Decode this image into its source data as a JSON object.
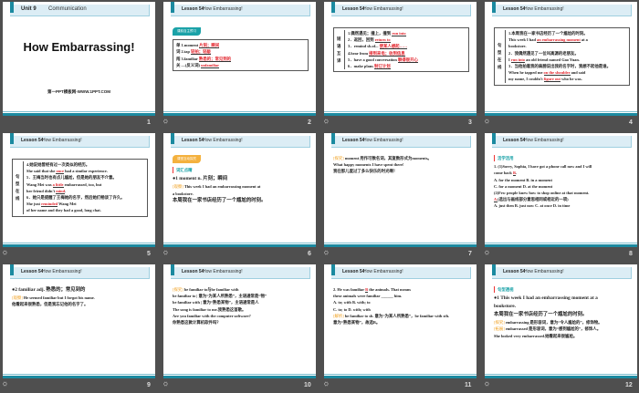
{
  "header": {
    "lesson": "Lesson 54",
    "title": "How Embarrassing!"
  },
  "slides": [
    {
      "number": "1",
      "unit": "Unit 9",
      "unit_title": "Communication",
      "title": "How Embarrassing!",
      "subtitle": "第一PPT模板网-WWW.1PPT.COM"
    },
    {
      "number": "2",
      "tag": "课前自主预习",
      "box": true,
      "lines": [
        {
          "t": "单 1.moment ",
          "a": "片刻；瞬间"
        },
        {
          "t": "词 2.tap ",
          "a": "轻拍；轻敲"
        },
        {
          "t": "闯 3.familiar ",
          "a": "熟悉的；常见到的"
        },
        {
          "t": "关 —(反义词) ",
          "a": "unfamiliar"
        }
      ]
    },
    {
      "number": "3",
      "box": true,
      "lines": [
        {
          "t": "1.偶然遇见；撞上，撞到 ",
          "a": "run into"
        },
        {
          "t": "2．返回，回到 ",
          "a": "return to"
        },
        {
          "t": "3．remind sb.of... ",
          "a": "使某人想起……"
        },
        {
          "t": "4.hear from ",
          "a": "接到来电；收到信息"
        },
        {
          "t": "5．have a good conversation ",
          "a": "聊得很开心"
        },
        {
          "t": "6．make plans ",
          "a": "制订计划"
        }
      ],
      "side": "短语互译"
    },
    {
      "number": "4",
      "box": true,
      "side": "句型在线",
      "lines": [
        {
          "t": "1.本周我在一家书店经历了一个尴尬的时刻。"
        },
        {
          "t": "This week I had ",
          "a": "an embarrassing moment",
          "t2": " at a"
        },
        {
          "t": "bookstore."
        },
        {
          "t": "2．我偶然遇见了一位叫高源的老朋友。"
        },
        {
          "t": "I ",
          "a": "run into",
          "t2": " an old friend named Gao Yuan."
        },
        {
          "t": "3．当他拍着我的肩膀说出我的名字时，我想不起他是谁。"
        },
        {
          "t": "When he tapped me ",
          "a": "on the shoulder",
          "t2": " and said"
        },
        {
          "t": "my name, I couldn't ",
          "a": "figure out",
          "t2": " who he was."
        }
      ]
    },
    {
      "number": "5",
      "box": true,
      "side": "句型在线",
      "lines": [
        {
          "t": "4.她说她曾经有过一次类似的经历。"
        },
        {
          "t": "She said that she ",
          "a": "once",
          "t2": " had a similar experience."
        },
        {
          "t": "5．王梅当时也有点儿尴尬，但是她的朋友不介意。"
        },
        {
          "t": "Wang Mei was ",
          "a": "a little",
          "t2": " embarrassed, too, but"
        },
        {
          "t": "her friend didn't ",
          "a": "mind",
          "t2": "."
        },
        {
          "t": "6．她只是提醒了王梅她的名字，然后她们畅谈了许久。"
        },
        {
          "t": "She just ",
          "a": "reminded",
          "t2": " Wang Mei "
        },
        {
          "t": "of her name and they had a good, long chat."
        }
      ]
    },
    {
      "number": "6",
      "tag": "课堂互动探究",
      "tagor": true,
      "sec": "词汇点睛",
      "lines": [
        {
          "t": "●1 moment n. 片刻；瞬间",
          "big": true
        },
        {
          "k": "[观察]",
          "t": " This week I had an embarrassing moment at"
        },
        {
          "t": "a bookstore."
        },
        {
          "t": "本周我在一家书店经历了一个尴尬的时刻。",
          "big": true
        }
      ]
    },
    {
      "number": "7",
      "lines": [
        {
          "k": "[探究]",
          "t": " moment 用作可数名词，其复数形式为moments。"
        },
        {
          "t": "What happy moments I have spent there!"
        },
        {
          "t": "我在那儿度过了多么快乐的时光啊！"
        }
      ]
    },
    {
      "number": "8",
      "sec": "活学活用",
      "lines": [
        {
          "t": "1. (1)Sorry, Sophia, I have got a phone call now and I will"
        },
        {
          "t": "come back ",
          "a": "B",
          "t2": "."
        },
        {
          "t": "   A. for the moment      B. in a moment"
        },
        {
          "t": "   C. for a moment        D. at the moment"
        },
        {
          "t": "  (2)Few people knew how to shop online at that moment."
        },
        {
          "a": "A ",
          "t": "  (选出与画线部分意思相同或相近的一项)"
        },
        {
          "t": "   A. just then  B. just now  C. at once  D. in time"
        }
      ]
    },
    {
      "number": "9",
      "lines": [
        {
          "t": "●2 familiar adj. 熟悉的；常见到的",
          "big": true
        },
        {
          "k": "[观察]",
          "t": " He seemed familiar but I forgot his name."
        },
        {
          "t": "他看起来很熟悉，但是我忘记他的名字了。"
        }
      ]
    },
    {
      "number": "10",
      "lines": [
        {
          "k": "[探究]",
          "t": " be familiar to与be familiar with"
        },
        {
          "t": "be familiar to | 意为“为某人所熟悉”，主语通常是“物”"
        },
        {
          "t": "be familiar with | 意为“熟悉某物”，主语通常是人"
        },
        {
          "t": " "
        },
        {
          "t": "The song is familiar to me.我熟悉这首歌。"
        },
        {
          "t": "Are you familiar with the computer software?"
        },
        {
          "t": "你熟悉这款计算机软件吗？"
        }
      ]
    },
    {
      "number": "11",
      "lines": [
        {
          "t": "2. He was familiar ",
          "a": "B",
          "t2": " the animals. That means"
        },
        {
          "t": "these animals were familiar ______ him."
        },
        {
          "t": "   A. to; with          B. with; to"
        },
        {
          "t": "   C. to; to            D. with; with"
        },
        {
          "t": " "
        },
        {
          "k": "[解析]",
          "t": " be familiar to sb. 意为“为某人所熟悉”，be familiar with sth."
        },
        {
          "t": "意为“熟悉某物”，故选B。"
        }
      ]
    },
    {
      "number": "12",
      "sec": "句型透视",
      "lines": [
        {
          "t": "●1 This week I had an embarrassing moment at a",
          "big": true
        },
        {
          "t": "bookstore.",
          "big": true
        },
        {
          "t": "本周我在一家书店经历了一个尴尬的时刻。",
          "big": true
        },
        {
          "k": "[探究]",
          "t": " embarrassing 是形容词，意为“令人尴尬的”，修饰物。"
        },
        {
          "k": "[拓展]",
          "t": " embarrassed 是形容词，意为“感到尴尬的”，修饰人。"
        },
        {
          "t": "She looked very embarrassed.她看起来很尴尬。"
        }
      ]
    }
  ]
}
